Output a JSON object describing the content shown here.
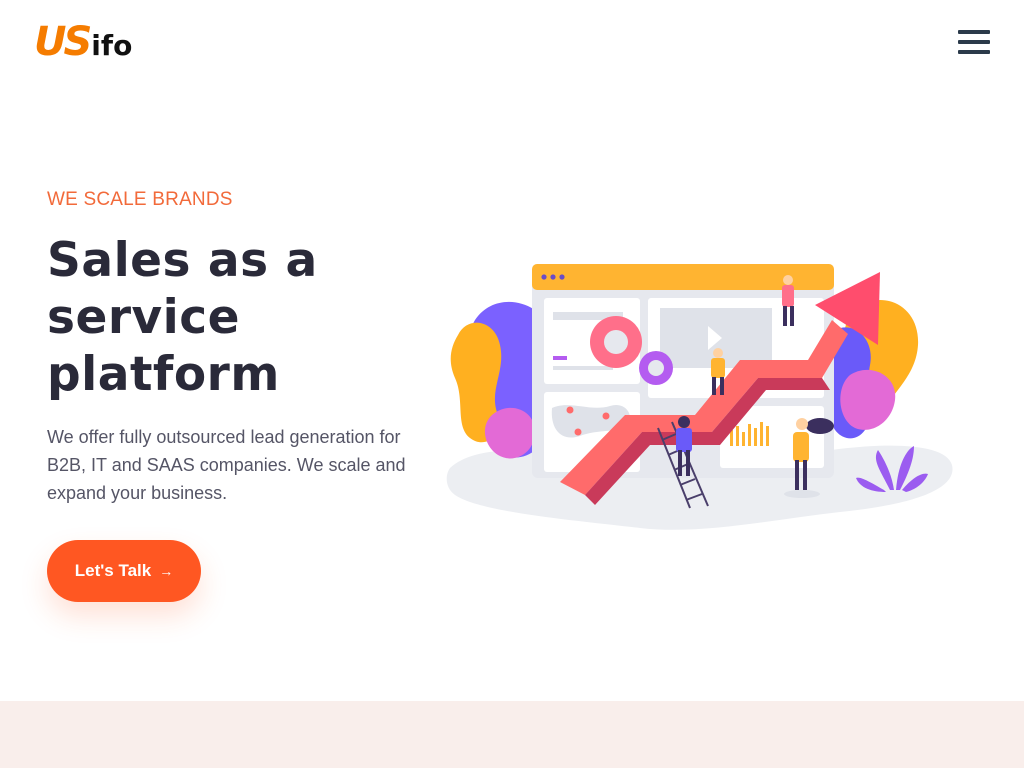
{
  "brand": {
    "logo_us": "US",
    "logo_rest": "ifo"
  },
  "nav": {
    "menu_icon": "hamburger-menu-icon"
  },
  "hero": {
    "eyebrow": "WE SCALE BRANDS",
    "headline_line1": "Sales as a",
    "headline_line2": "service",
    "headline_line3": "platform",
    "description": "We offer fully outsourced lead generation for B2B, IT and SAAS companies. We scale and expand your business.",
    "cta_label": "Let's Talk",
    "cta_icon": "arrow-right-icon"
  },
  "colors": {
    "accent": "#ff5722",
    "eyebrow": "#f26a3a",
    "heading": "#2a2a39",
    "body_text": "#555566",
    "band_background": "#f9eeeb",
    "logo_orange": "#f57c00"
  }
}
